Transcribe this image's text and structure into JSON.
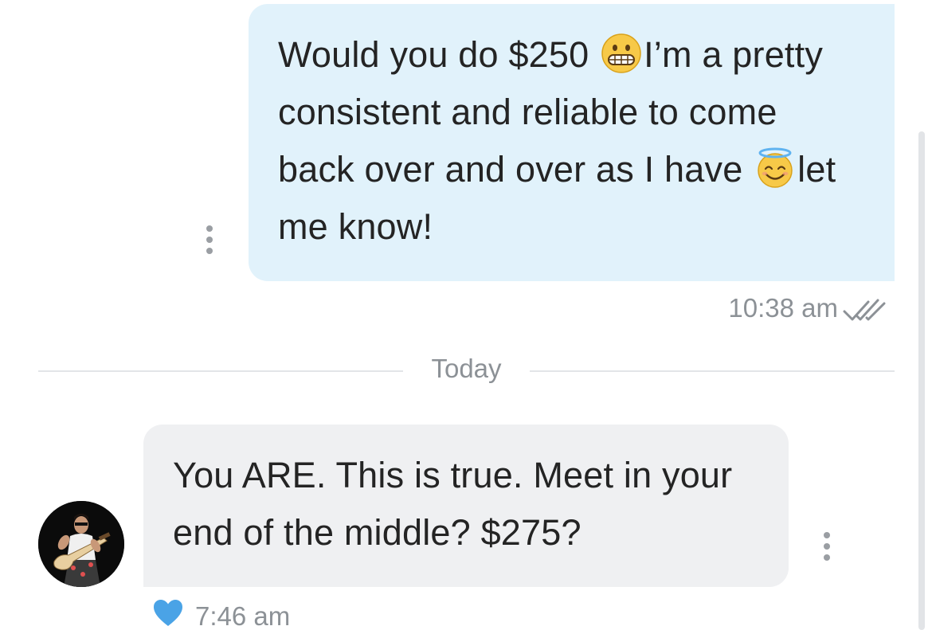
{
  "conversation": {
    "outgoing": {
      "lines": [
        {
          "before": "Would you do $250 ",
          "emoji": "grimacing-face",
          "after": "I’m a pretty"
        },
        {
          "before": "consistent and reliable to come",
          "emoji": null,
          "after": ""
        },
        {
          "before": "back over and over as I have ",
          "emoji": "smiling-face-with-halo",
          "after": "let"
        },
        {
          "before": "me know!",
          "emoji": null,
          "after": ""
        }
      ],
      "time": "10:38 am",
      "status_icon": "double-check-icon"
    },
    "divider": {
      "label": "Today"
    },
    "incoming": {
      "lines": [
        "You ARE. This is true. Meet in your",
        "end of the middle? $275?"
      ],
      "time": "7:46 am",
      "reaction_icon": "heart-icon",
      "reaction_color": "#4aa3e6"
    }
  },
  "colors": {
    "outgoing_bubble": "#e1f2fb",
    "incoming_bubble": "#eff0f2",
    "meta_text": "#8c9196"
  }
}
